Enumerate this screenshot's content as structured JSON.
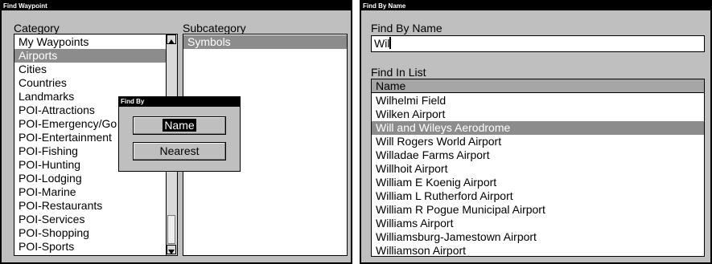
{
  "find_waypoint": {
    "title": "Find Waypoint",
    "category_label": "Category",
    "subcategory_label": "Subcategory",
    "categories": [
      {
        "label": "My Waypoints",
        "selected": false
      },
      {
        "label": "Airports",
        "selected": true
      },
      {
        "label": "Cities",
        "selected": false
      },
      {
        "label": "Countries",
        "selected": false
      },
      {
        "label": "Landmarks",
        "selected": false
      },
      {
        "label": "POI-Attractions",
        "selected": false
      },
      {
        "label": "POI-Emergency/Go",
        "selected": false
      },
      {
        "label": "POI-Entertainment",
        "selected": false
      },
      {
        "label": "POI-Fishing",
        "selected": false
      },
      {
        "label": "POI-Hunting",
        "selected": false
      },
      {
        "label": "POI-Lodging",
        "selected": false
      },
      {
        "label": "POI-Marine",
        "selected": false
      },
      {
        "label": "POI-Restaurants",
        "selected": false
      },
      {
        "label": "POI-Services",
        "selected": false
      },
      {
        "label": "POI-Shopping",
        "selected": false
      },
      {
        "label": "POI-Sports",
        "selected": false
      }
    ],
    "subcategories": [
      {
        "label": "Symbols",
        "selected": true
      }
    ]
  },
  "find_by_dialog": {
    "title": "Find By",
    "buttons": [
      {
        "label": "Name",
        "highlighted": true
      },
      {
        "label": "Nearest",
        "highlighted": false
      }
    ]
  },
  "find_by_name": {
    "title": "Find By Name",
    "field_label": "Find By Name",
    "field_value": "Wil",
    "list_label": "Find In List",
    "column_header": "Name",
    "results": [
      {
        "label": "Wilhelmi Field",
        "selected": false
      },
      {
        "label": "Wilken Airport",
        "selected": false
      },
      {
        "label": "Will and Wileys Aerodrome",
        "selected": true
      },
      {
        "label": "Will Rogers World Airport",
        "selected": false
      },
      {
        "label": "Willadae Farms Airport",
        "selected": false
      },
      {
        "label": "Willhoit Airport",
        "selected": false
      },
      {
        "label": "William E Koenig Airport",
        "selected": false
      },
      {
        "label": "William L Rutherford Airport",
        "selected": false
      },
      {
        "label": "William R Pogue Municipal Airport",
        "selected": false
      },
      {
        "label": "Williams Airport",
        "selected": false
      },
      {
        "label": "Williamsburg-Jamestown Airport",
        "selected": false
      },
      {
        "label": "Williamson Airport",
        "selected": false
      }
    ]
  },
  "colors": {
    "screen_bg": "#bfbfbf",
    "selection": "#8c8c8c",
    "title_bar": "#000000",
    "list_bg": "#ffffff"
  }
}
